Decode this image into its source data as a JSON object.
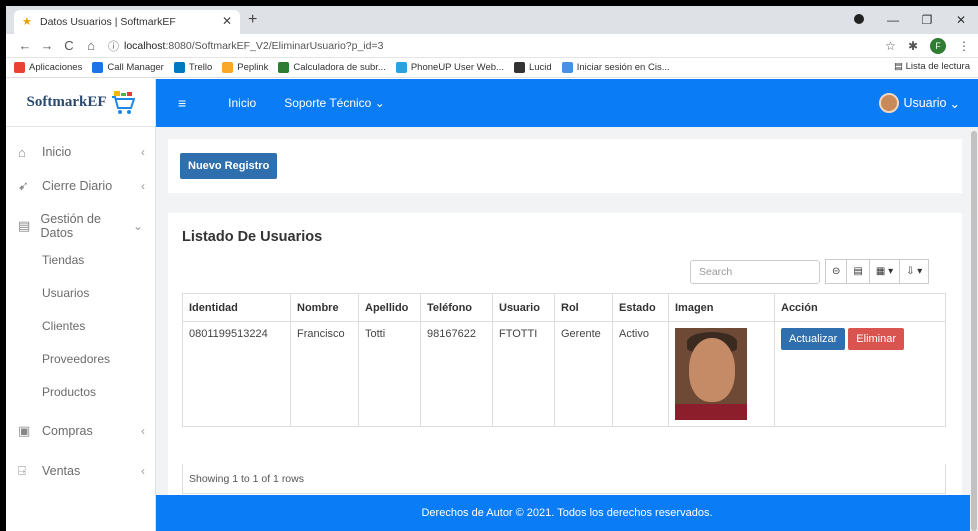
{
  "browser": {
    "tab_title": "Datos Usuarios | SoftmarkEF",
    "url_host": "localhost",
    "url_rest": ":8080/SoftmarkEF_V2/EliminarUsuario?p_id=3",
    "profile_letter": "F",
    "bookmarks": [
      {
        "label": "Aplicaciones",
        "color": "#e94235"
      },
      {
        "label": "Call Manager",
        "color": "#1a73e8"
      },
      {
        "label": "Trello",
        "color": "#0079bf"
      },
      {
        "label": "Peplink",
        "color": "#f9a825"
      },
      {
        "label": "Calculadora de subr...",
        "color": "#2e7d32"
      },
      {
        "label": "PhoneUP User Web...",
        "color": "#29a3e0"
      },
      {
        "label": "Lucid",
        "color": "#333333"
      },
      {
        "label": "Iniciar sesión en Cis...",
        "color": "#4a90e2"
      }
    ],
    "reading_list": "Lista de lectura"
  },
  "sidebar": {
    "brand": "SoftmarkEF",
    "items": [
      {
        "label": "Inicio",
        "icon": "home-icon"
      },
      {
        "label": "Cierre Diario",
        "icon": "rocket-icon"
      },
      {
        "label": "Gestión de Datos",
        "icon": "document-icon"
      }
    ],
    "subitems": [
      "Tiendas",
      "Usuarios",
      "Clientes",
      "Proveedores",
      "Productos"
    ],
    "bottom_items": [
      {
        "label": "Compras",
        "icon": "calendar-icon"
      },
      {
        "label": "Ventas",
        "icon": "door-icon"
      }
    ]
  },
  "topnav": {
    "home": "Inicio",
    "support": "Soporte Técnico",
    "user": "Usuario"
  },
  "main": {
    "new_button": "Nuevo Registro",
    "title": "Listado De Usuarios",
    "search_placeholder": "Search",
    "columns": [
      "Identidad",
      "Nombre",
      "Apellido",
      "Teléfono",
      "Usuario",
      "Rol",
      "Estado",
      "Imagen",
      "Acción"
    ],
    "row": {
      "identidad": "0801199513224",
      "nombre": "Francisco",
      "apellido": "Totti",
      "telefono": "98167622",
      "usuario": "FTOTTI",
      "rol": "Gerente",
      "estado": "Activo"
    },
    "update_button": "Actualizar",
    "delete_button": "Eliminar",
    "showing": "Showing 1 to 1 of 1 rows"
  },
  "footer": "Derechos de Autor © 2021. Todos los derechos reservados.",
  "colors": {
    "primary": "#0a7cf5",
    "button": "#2f6fad",
    "danger": "#d9534f"
  }
}
